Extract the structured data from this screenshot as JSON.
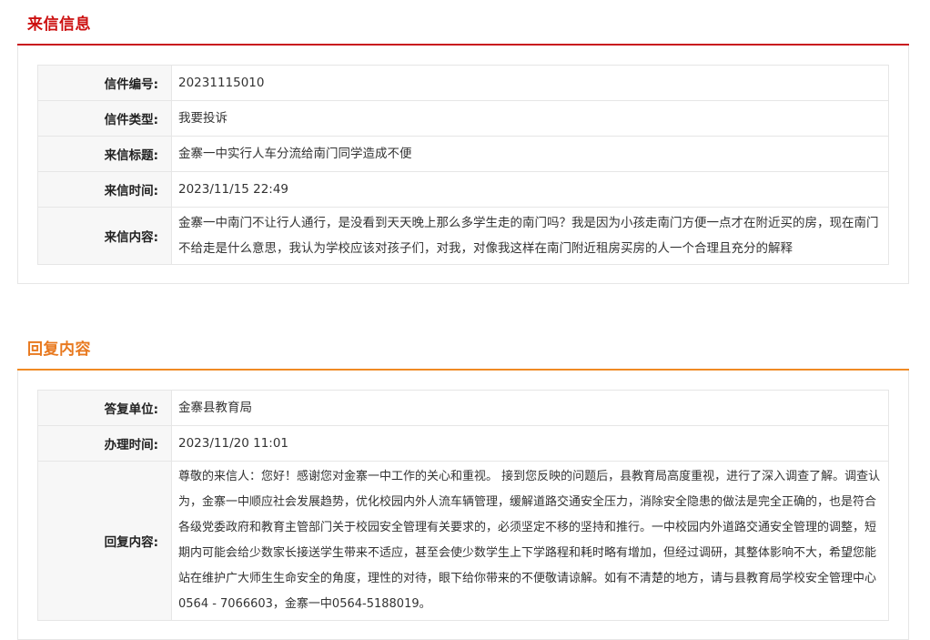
{
  "letter_section": {
    "title": "来信信息",
    "rows": [
      {
        "label": "信件编号:",
        "value": "20231115010"
      },
      {
        "label": "信件类型:",
        "value": "我要投诉"
      },
      {
        "label": "来信标题:",
        "value": "金寨一中实行人车分流给南门同学造成不便"
      },
      {
        "label": "来信时间:",
        "value": "2023/11/15 22:49"
      },
      {
        "label": "来信内容:",
        "value": "金寨一中南门不让行人通行，是没看到天天晚上那么多学生走的南门吗？我是因为小孩走南门方便一点才在附近买的房，现在南门不给走是什么意思，我认为学校应该对孩子们，对我，对像我这样在南门附近租房买房的人一个合理且充分的解释"
      }
    ]
  },
  "reply_section": {
    "title": "回复内容",
    "rows": [
      {
        "label": "答复单位:",
        "value": "金寨县教育局"
      },
      {
        "label": "办理时间:",
        "value": "2023/11/20 11:01"
      },
      {
        "label": "回复内容:",
        "value": "尊敬的来信人：您好！感谢您对金寨一中工作的关心和重视。 接到您反映的问题后，县教育局高度重视，进行了深入调查了解。调查认为，金寨一中顺应社会发展趋势，优化校园内外人流车辆管理，缓解道路交通安全压力，消除安全隐患的做法是完全正确的，也是符合各级党委政府和教育主管部门关于校园安全管理有关要求的，必须坚定不移的坚持和推行。一中校园内外道路交通安全管理的调整，短期内可能会给少数家长接送学生带来不适应，甚至会使少数学生上下学路程和耗时略有增加，但经过调研，其整体影响不大，希望您能站在维护广大师生生命安全的角度，理性的对待，眼下给你带来的不便敬请谅解。如有不清楚的地方，请与县教育局学校安全管理中心0564 - 7066603，金寨一中0564-5188019。"
      }
    ]
  }
}
